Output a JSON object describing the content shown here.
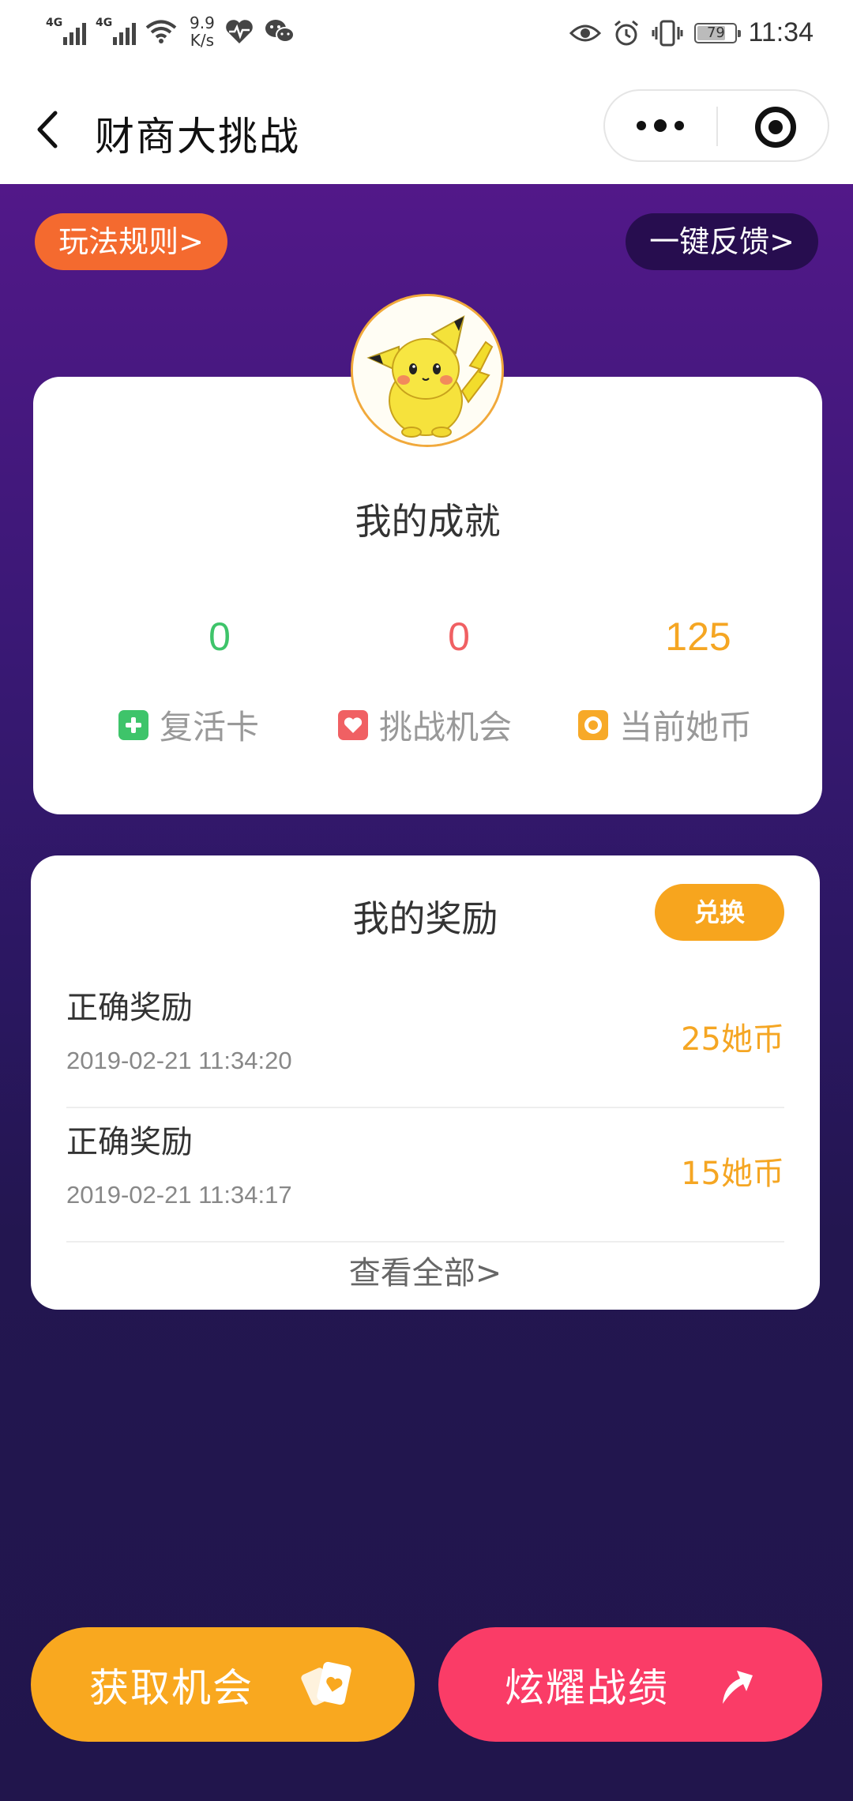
{
  "status_bar": {
    "net1": "4G",
    "net2": "4G",
    "speed_value": "9.9",
    "speed_unit": "K/s",
    "battery": "79",
    "time": "11:34",
    "icons": [
      "signal-icon",
      "wifi-icon",
      "health-icon",
      "wechat-icon",
      "eye-icon",
      "alarm-icon",
      "vibrate-icon",
      "battery-icon"
    ]
  },
  "nav": {
    "title": "财商大挑战",
    "icons": [
      "back-arrow-icon",
      "more-dots-icon",
      "target-icon"
    ]
  },
  "top_buttons": {
    "rules": "玩法规则>",
    "feedback": "一键反馈>"
  },
  "achievements": {
    "title": "我的成就",
    "stats": [
      {
        "value": "0",
        "label": "复活卡",
        "icon": "plus-card-icon",
        "color": "#3ec46a"
      },
      {
        "value": "0",
        "label": "挑战机会",
        "icon": "heart-icon",
        "color": "#f06063"
      },
      {
        "value": "125",
        "label": "当前她币",
        "icon": "coin-icon",
        "color": "#f5a623"
      }
    ]
  },
  "rewards": {
    "title": "我的奖励",
    "exchange": "兑换",
    "items": [
      {
        "name": "正确奖励",
        "time": "2019-02-21 11:34:20",
        "amount": "25她币"
      },
      {
        "name": "正确奖励",
        "time": "2019-02-21 11:34:17",
        "amount": "15她币"
      }
    ],
    "view_all": "查看全部>"
  },
  "bottom_buttons": {
    "chance": "获取机会",
    "show": "炫耀战绩",
    "icons": [
      "card-heart-icon",
      "share-arrow-icon"
    ]
  },
  "colors": {
    "bg_top": "#521889",
    "bg_bottom": "#21154c",
    "orange": "#f9a81f",
    "pink": "#fa3c67",
    "rules_orange": "#f46a2f"
  }
}
